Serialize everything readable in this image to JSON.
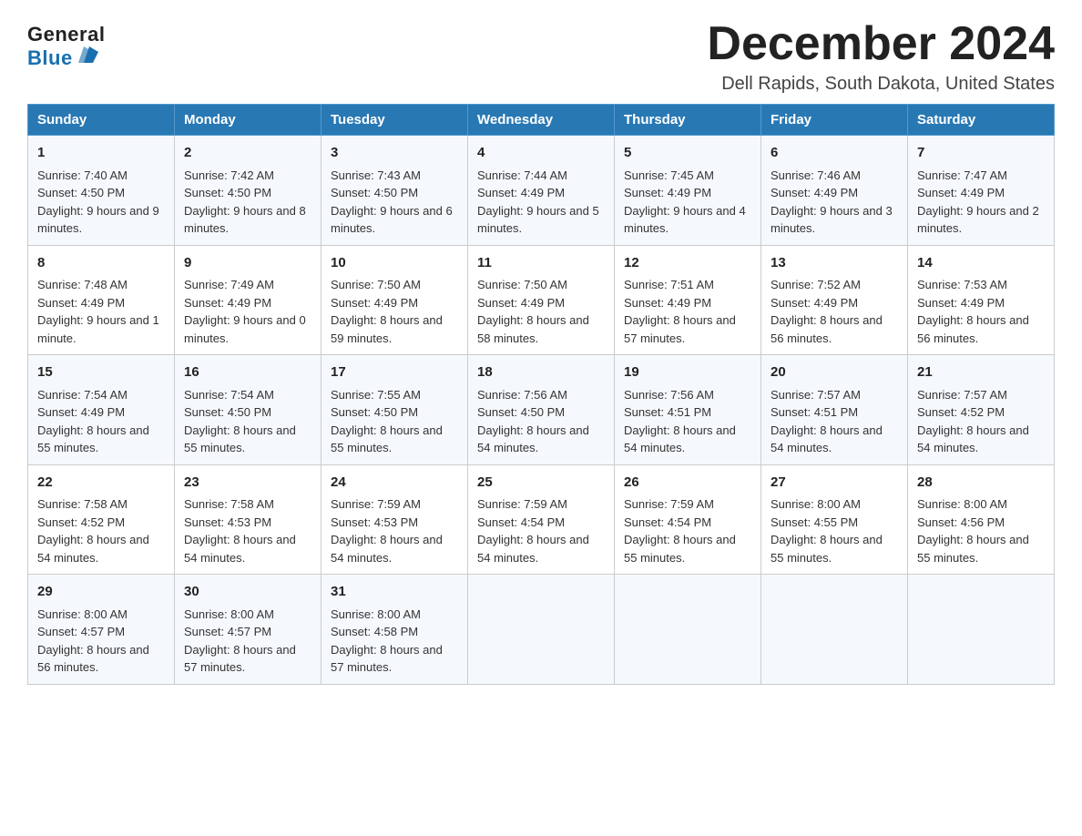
{
  "logo": {
    "general": "General",
    "blue": "Blue"
  },
  "title": "December 2024",
  "location": "Dell Rapids, South Dakota, United States",
  "days_of_week": [
    "Sunday",
    "Monday",
    "Tuesday",
    "Wednesday",
    "Thursday",
    "Friday",
    "Saturday"
  ],
  "weeks": [
    [
      {
        "day": "1",
        "sunrise": "7:40 AM",
        "sunset": "4:50 PM",
        "daylight": "9 hours and 9 minutes."
      },
      {
        "day": "2",
        "sunrise": "7:42 AM",
        "sunset": "4:50 PM",
        "daylight": "9 hours and 8 minutes."
      },
      {
        "day": "3",
        "sunrise": "7:43 AM",
        "sunset": "4:50 PM",
        "daylight": "9 hours and 6 minutes."
      },
      {
        "day": "4",
        "sunrise": "7:44 AM",
        "sunset": "4:49 PM",
        "daylight": "9 hours and 5 minutes."
      },
      {
        "day": "5",
        "sunrise": "7:45 AM",
        "sunset": "4:49 PM",
        "daylight": "9 hours and 4 minutes."
      },
      {
        "day": "6",
        "sunrise": "7:46 AM",
        "sunset": "4:49 PM",
        "daylight": "9 hours and 3 minutes."
      },
      {
        "day": "7",
        "sunrise": "7:47 AM",
        "sunset": "4:49 PM",
        "daylight": "9 hours and 2 minutes."
      }
    ],
    [
      {
        "day": "8",
        "sunrise": "7:48 AM",
        "sunset": "4:49 PM",
        "daylight": "9 hours and 1 minute."
      },
      {
        "day": "9",
        "sunrise": "7:49 AM",
        "sunset": "4:49 PM",
        "daylight": "9 hours and 0 minutes."
      },
      {
        "day": "10",
        "sunrise": "7:50 AM",
        "sunset": "4:49 PM",
        "daylight": "8 hours and 59 minutes."
      },
      {
        "day": "11",
        "sunrise": "7:50 AM",
        "sunset": "4:49 PM",
        "daylight": "8 hours and 58 minutes."
      },
      {
        "day": "12",
        "sunrise": "7:51 AM",
        "sunset": "4:49 PM",
        "daylight": "8 hours and 57 minutes."
      },
      {
        "day": "13",
        "sunrise": "7:52 AM",
        "sunset": "4:49 PM",
        "daylight": "8 hours and 56 minutes."
      },
      {
        "day": "14",
        "sunrise": "7:53 AM",
        "sunset": "4:49 PM",
        "daylight": "8 hours and 56 minutes."
      }
    ],
    [
      {
        "day": "15",
        "sunrise": "7:54 AM",
        "sunset": "4:49 PM",
        "daylight": "8 hours and 55 minutes."
      },
      {
        "day": "16",
        "sunrise": "7:54 AM",
        "sunset": "4:50 PM",
        "daylight": "8 hours and 55 minutes."
      },
      {
        "day": "17",
        "sunrise": "7:55 AM",
        "sunset": "4:50 PM",
        "daylight": "8 hours and 55 minutes."
      },
      {
        "day": "18",
        "sunrise": "7:56 AM",
        "sunset": "4:50 PM",
        "daylight": "8 hours and 54 minutes."
      },
      {
        "day": "19",
        "sunrise": "7:56 AM",
        "sunset": "4:51 PM",
        "daylight": "8 hours and 54 minutes."
      },
      {
        "day": "20",
        "sunrise": "7:57 AM",
        "sunset": "4:51 PM",
        "daylight": "8 hours and 54 minutes."
      },
      {
        "day": "21",
        "sunrise": "7:57 AM",
        "sunset": "4:52 PM",
        "daylight": "8 hours and 54 minutes."
      }
    ],
    [
      {
        "day": "22",
        "sunrise": "7:58 AM",
        "sunset": "4:52 PM",
        "daylight": "8 hours and 54 minutes."
      },
      {
        "day": "23",
        "sunrise": "7:58 AM",
        "sunset": "4:53 PM",
        "daylight": "8 hours and 54 minutes."
      },
      {
        "day": "24",
        "sunrise": "7:59 AM",
        "sunset": "4:53 PM",
        "daylight": "8 hours and 54 minutes."
      },
      {
        "day": "25",
        "sunrise": "7:59 AM",
        "sunset": "4:54 PM",
        "daylight": "8 hours and 54 minutes."
      },
      {
        "day": "26",
        "sunrise": "7:59 AM",
        "sunset": "4:54 PM",
        "daylight": "8 hours and 55 minutes."
      },
      {
        "day": "27",
        "sunrise": "8:00 AM",
        "sunset": "4:55 PM",
        "daylight": "8 hours and 55 minutes."
      },
      {
        "day": "28",
        "sunrise": "8:00 AM",
        "sunset": "4:56 PM",
        "daylight": "8 hours and 55 minutes."
      }
    ],
    [
      {
        "day": "29",
        "sunrise": "8:00 AM",
        "sunset": "4:57 PM",
        "daylight": "8 hours and 56 minutes."
      },
      {
        "day": "30",
        "sunrise": "8:00 AM",
        "sunset": "4:57 PM",
        "daylight": "8 hours and 57 minutes."
      },
      {
        "day": "31",
        "sunrise": "8:00 AM",
        "sunset": "4:58 PM",
        "daylight": "8 hours and 57 minutes."
      },
      null,
      null,
      null,
      null
    ]
  ],
  "labels": {
    "sunrise": "Sunrise:",
    "sunset": "Sunset:",
    "daylight": "Daylight:"
  }
}
